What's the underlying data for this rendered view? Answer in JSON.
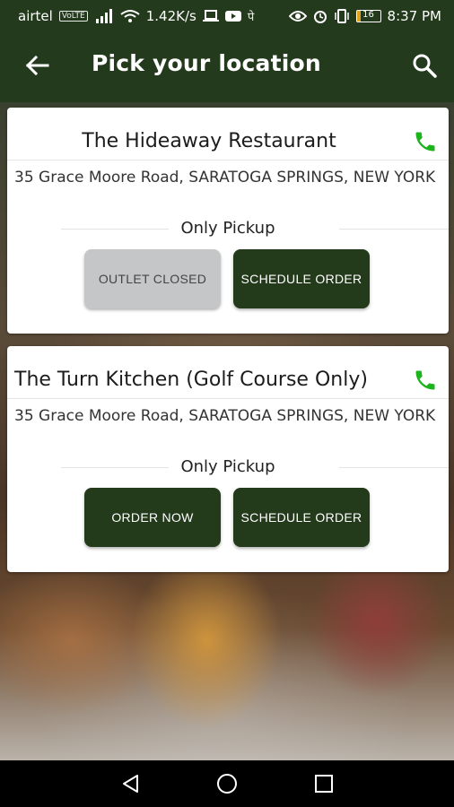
{
  "status_bar": {
    "carrier": "airtel",
    "volte": "VoLTE",
    "speed": "1.42K/s",
    "battery": "16",
    "time": "8:37 PM"
  },
  "app_bar": {
    "title": "Pick your location"
  },
  "locations": [
    {
      "name": "The Hideaway Restaurant",
      "address": "35 Grace Moore Road, SARATOGA SPRINGS, NEW YORK",
      "mode": "Only Pickup",
      "left_button": "OUTLET CLOSED",
      "right_button": "SCHEDULE ORDER"
    },
    {
      "name": "The Turn Kitchen (Golf Course Only)",
      "address": "35 Grace Moore Road, SARATOGA SPRINGS, NEW YORK",
      "mode": "Only Pickup",
      "left_button": "ORDER NOW",
      "right_button": "SCHEDULE ORDER"
    }
  ],
  "colors": {
    "primary": "#233a1b",
    "phone_green": "#1db31d",
    "disabled_gray": "#c4c6c8"
  }
}
